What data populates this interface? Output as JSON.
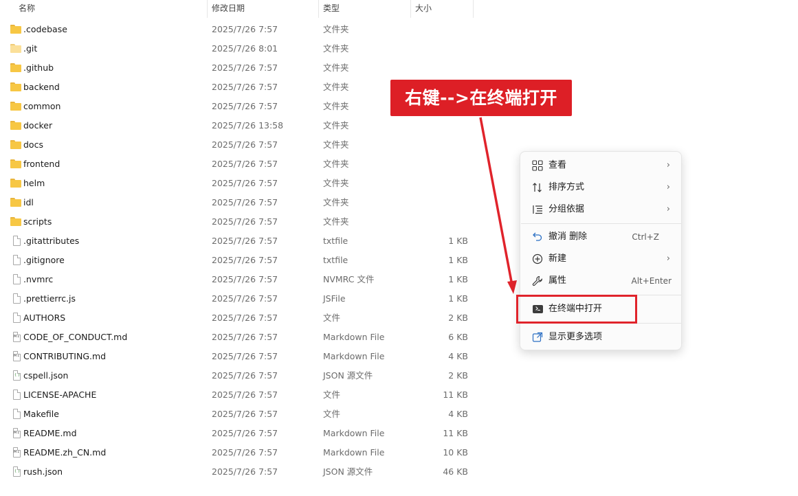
{
  "columns": {
    "name": "名称",
    "date": "修改日期",
    "type": "类型",
    "size": "大小"
  },
  "files": [
    {
      "name": ".codebase",
      "date": "2025/7/26 7:57",
      "type": "文件夹",
      "size": "",
      "icon": "folder-icon"
    },
    {
      "name": ".git",
      "date": "2025/7/26 8:01",
      "type": "文件夹",
      "size": "",
      "icon": "folder-icon"
    },
    {
      "name": ".github",
      "date": "2025/7/26 7:57",
      "type": "文件夹",
      "size": "",
      "icon": "folder-icon"
    },
    {
      "name": "backend",
      "date": "2025/7/26 7:57",
      "type": "文件夹",
      "size": "",
      "icon": "folder-icon"
    },
    {
      "name": "common",
      "date": "2025/7/26 7:57",
      "type": "文件夹",
      "size": "",
      "icon": "folder-icon"
    },
    {
      "name": "docker",
      "date": "2025/7/26 13:58",
      "type": "文件夹",
      "size": "",
      "icon": "folder-icon"
    },
    {
      "name": "docs",
      "date": "2025/7/26 7:57",
      "type": "文件夹",
      "size": "",
      "icon": "folder-icon"
    },
    {
      "name": "frontend",
      "date": "2025/7/26 7:57",
      "type": "文件夹",
      "size": "",
      "icon": "folder-icon"
    },
    {
      "name": "helm",
      "date": "2025/7/26 7:57",
      "type": "文件夹",
      "size": "",
      "icon": "folder-icon"
    },
    {
      "name": "idl",
      "date": "2025/7/26 7:57",
      "type": "文件夹",
      "size": "",
      "icon": "folder-icon"
    },
    {
      "name": "scripts",
      "date": "2025/7/26 7:57",
      "type": "文件夹",
      "size": "",
      "icon": "folder-icon"
    },
    {
      "name": ".gitattributes",
      "date": "2025/7/26 7:57",
      "type": "txtfile",
      "size": "1 KB",
      "icon": "file-icon"
    },
    {
      "name": ".gitignore",
      "date": "2025/7/26 7:57",
      "type": "txtfile",
      "size": "1 KB",
      "icon": "file-icon"
    },
    {
      "name": ".nvmrc",
      "date": "2025/7/26 7:57",
      "type": "NVMRC 文件",
      "size": "1 KB",
      "icon": "file-icon"
    },
    {
      "name": ".prettierrc.js",
      "date": "2025/7/26 7:57",
      "type": "JSFile",
      "size": "1 KB",
      "icon": "file-icon"
    },
    {
      "name": "AUTHORS",
      "date": "2025/7/26 7:57",
      "type": "文件",
      "size": "2 KB",
      "icon": "file-icon"
    },
    {
      "name": "CODE_OF_CONDUCT.md",
      "date": "2025/7/26 7:57",
      "type": "Markdown File",
      "size": "6 KB",
      "icon": "markdown-file-icon"
    },
    {
      "name": "CONTRIBUTING.md",
      "date": "2025/7/26 7:57",
      "type": "Markdown File",
      "size": "4 KB",
      "icon": "markdown-file-icon"
    },
    {
      "name": "cspell.json",
      "date": "2025/7/26 7:57",
      "type": "JSON 源文件",
      "size": "2 KB",
      "icon": "json-file-icon"
    },
    {
      "name": "LICENSE-APACHE",
      "date": "2025/7/26 7:57",
      "type": "文件",
      "size": "11 KB",
      "icon": "file-icon"
    },
    {
      "name": "Makefile",
      "date": "2025/7/26 7:57",
      "type": "文件",
      "size": "4 KB",
      "icon": "file-icon"
    },
    {
      "name": "README.md",
      "date": "2025/7/26 7:57",
      "type": "Markdown File",
      "size": "11 KB",
      "icon": "markdown-file-icon"
    },
    {
      "name": "README.zh_CN.md",
      "date": "2025/7/26 7:57",
      "type": "Markdown File",
      "size": "10 KB",
      "icon": "markdown-file-icon"
    },
    {
      "name": "rush.json",
      "date": "2025/7/26 7:57",
      "type": "JSON 源文件",
      "size": "46 KB",
      "icon": "json-file-icon"
    }
  ],
  "context_menu": {
    "view": {
      "label": "查看",
      "icon": "grid-icon"
    },
    "sort": {
      "label": "排序方式",
      "icon": "sort-icon"
    },
    "group": {
      "label": "分组依据",
      "icon": "group-icon"
    },
    "undo": {
      "label": "撤消 删除",
      "shortcut": "Ctrl+Z",
      "icon": "undo-icon"
    },
    "new": {
      "label": "新建",
      "icon": "add-circle-icon"
    },
    "properties": {
      "label": "属性",
      "shortcut": "Alt+Enter",
      "icon": "wrench-icon"
    },
    "open_terminal": {
      "label": "在终端中打开",
      "icon": "terminal-icon"
    },
    "more_options": {
      "label": "显示更多选项",
      "icon": "external-link-icon"
    }
  },
  "annotation": {
    "text": "右键-->在终端打开",
    "color": "#dd1f26"
  }
}
